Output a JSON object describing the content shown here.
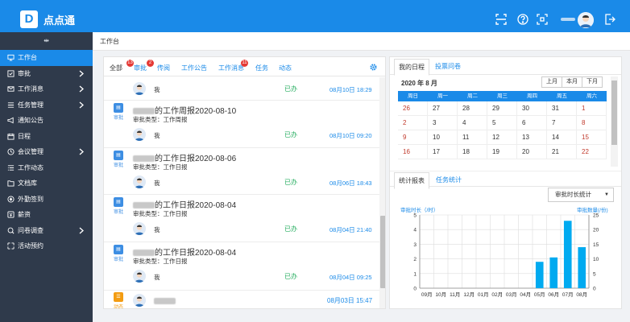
{
  "app": {
    "title": "点点通",
    "logo_letter": "D"
  },
  "sidebar": {
    "toggle": "⇹",
    "items": [
      {
        "label": "工作台",
        "icon": "monitor-icon",
        "active": true,
        "chevron": false
      },
      {
        "label": "审批",
        "icon": "approve-icon",
        "chevron": true
      },
      {
        "label": "工作消息",
        "icon": "mail-icon",
        "chevron": true
      },
      {
        "label": "任务管理",
        "icon": "task-icon",
        "chevron": true
      },
      {
        "label": "通知公告",
        "icon": "megaphone-icon",
        "chevron": false
      },
      {
        "label": "日程",
        "icon": "calendar-icon",
        "chevron": false
      },
      {
        "label": "会议管理",
        "icon": "meeting-icon",
        "chevron": true
      },
      {
        "label": "工作动态",
        "icon": "news-icon",
        "chevron": false
      },
      {
        "label": "文档库",
        "icon": "folder-icon",
        "chevron": false
      },
      {
        "label": "外勤签到",
        "icon": "location-icon",
        "chevron": false
      },
      {
        "label": "薪资",
        "icon": "salary-icon",
        "chevron": false
      },
      {
        "label": "问卷调查",
        "icon": "survey-icon",
        "chevron": true
      },
      {
        "label": "活动预约",
        "icon": "activity-icon",
        "chevron": false
      }
    ]
  },
  "breadcrumb": {
    "current": "工作台"
  },
  "feed": {
    "tabs": [
      {
        "label": "全部",
        "badge": "13"
      },
      {
        "label": "审批",
        "badge": "2"
      },
      {
        "label": "传阅",
        "badge": ""
      },
      {
        "label": "工作公告",
        "badge": ""
      },
      {
        "label": "工作消息",
        "badge": "11"
      },
      {
        "label": "任务",
        "badge": ""
      },
      {
        "label": "动态",
        "badge": ""
      }
    ],
    "top_row": {
      "actor": "我",
      "status": "已办",
      "time": "08月10日 18:29"
    },
    "items": [
      {
        "tile_label": "审批",
        "title_suffix": "的工作周报2020-08-10",
        "type": "审批类型：工作周报",
        "actor": "我",
        "status": "已办",
        "time": "08月10日 09:20"
      },
      {
        "tile_label": "审批",
        "title_suffix": "的工作日报2020-08-06",
        "type": "审批类型：工作日报",
        "actor": "我",
        "status": "已办",
        "time": "08月06日 18:43"
      },
      {
        "tile_label": "审批",
        "title_suffix": "的工作日报2020-08-04",
        "type": "审批类型：工作日报",
        "actor": "我",
        "status": "已办",
        "time": "08月04日 21:40"
      },
      {
        "tile_label": "审批",
        "title_suffix": "的工作日报2020-08-04",
        "type": "审批类型：工作日报",
        "actor": "我",
        "status": "已办",
        "time": "08月04日 09:25"
      }
    ],
    "bottom_row": {
      "tile_label": "动态",
      "time": "08月03日 15:47"
    }
  },
  "calendar": {
    "tabs": [
      "我的日程",
      "投票问卷"
    ],
    "month_label": "2020 年 8 月",
    "buttons": [
      "上月",
      "本月",
      "下月"
    ],
    "weekdays": [
      "周日",
      "周一",
      "周二",
      "周三",
      "周四",
      "周五",
      "周六"
    ],
    "weeks": [
      [
        "26",
        "27",
        "28",
        "29",
        "30",
        "31",
        "1"
      ],
      [
        "2",
        "3",
        "4",
        "5",
        "6",
        "7",
        "8"
      ],
      [
        "9",
        "10",
        "11",
        "12",
        "13",
        "14",
        "15"
      ],
      [
        "16",
        "17",
        "18",
        "19",
        "20",
        "21",
        "22"
      ]
    ]
  },
  "stats": {
    "tabs": [
      "统计报表",
      "任务统计"
    ],
    "select_value": "审批时长统计"
  },
  "chart_data": {
    "type": "bar",
    "categories": [
      "09月",
      "10月",
      "11月",
      "12月",
      "01月",
      "02月",
      "03月",
      "04月",
      "05月",
      "06月",
      "07月",
      "08月"
    ],
    "series": [
      {
        "name": "审批时长",
        "values": [
          0,
          0,
          0,
          0,
          0,
          0,
          0,
          0,
          1.8,
          2.1,
          4.6,
          2.8
        ]
      }
    ],
    "ylabel_left": "审批时长（/时）",
    "ylabel_right": "审批数量(/份)",
    "ylim_left": [
      0,
      5
    ],
    "ylim_right": [
      0,
      25
    ],
    "yticks_left": [
      "5",
      "4",
      "3",
      "2",
      "1",
      "0"
    ],
    "yticks_right": [
      "25",
      "20",
      "15",
      "10",
      "5",
      "0"
    ],
    "grid": true,
    "bar_color": "#00aaf0"
  }
}
